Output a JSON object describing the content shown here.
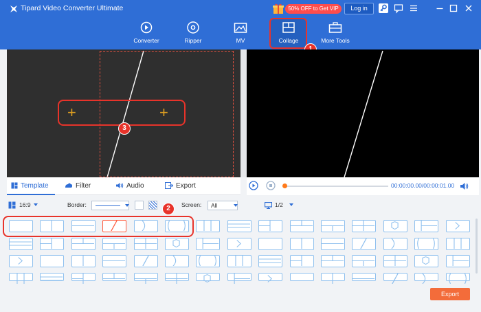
{
  "app": {
    "title": "Tipard Video Converter Ultimate"
  },
  "header": {
    "vip_label": "50% OFF to Get VIP",
    "login_label": "Log in"
  },
  "nav": [
    {
      "label": "Converter",
      "icon": "converter-icon"
    },
    {
      "label": "Ripper",
      "icon": "ripper-icon"
    },
    {
      "label": "MV",
      "icon": "mv-icon"
    },
    {
      "label": "Collage",
      "icon": "collage-icon",
      "active": true
    },
    {
      "label": "More Tools",
      "icon": "toolbox-icon"
    }
  ],
  "callouts": [
    "1",
    "2",
    "3"
  ],
  "tabs": [
    {
      "label": "Template",
      "active": true
    },
    {
      "label": "Filter"
    },
    {
      "label": "Audio"
    },
    {
      "label": "Export"
    }
  ],
  "player": {
    "time": "00:00:00.00/00:00:01.00",
    "progress": 0
  },
  "settings": {
    "aspect": "16:9",
    "border_label": "Border:",
    "screen_label": "Screen:",
    "screen_value": "All",
    "page": "1/2"
  },
  "export_label": "Export",
  "colors": {
    "brand": "#2f6ed6",
    "accent": "#f36c3a",
    "highlight": "#e8332a"
  }
}
